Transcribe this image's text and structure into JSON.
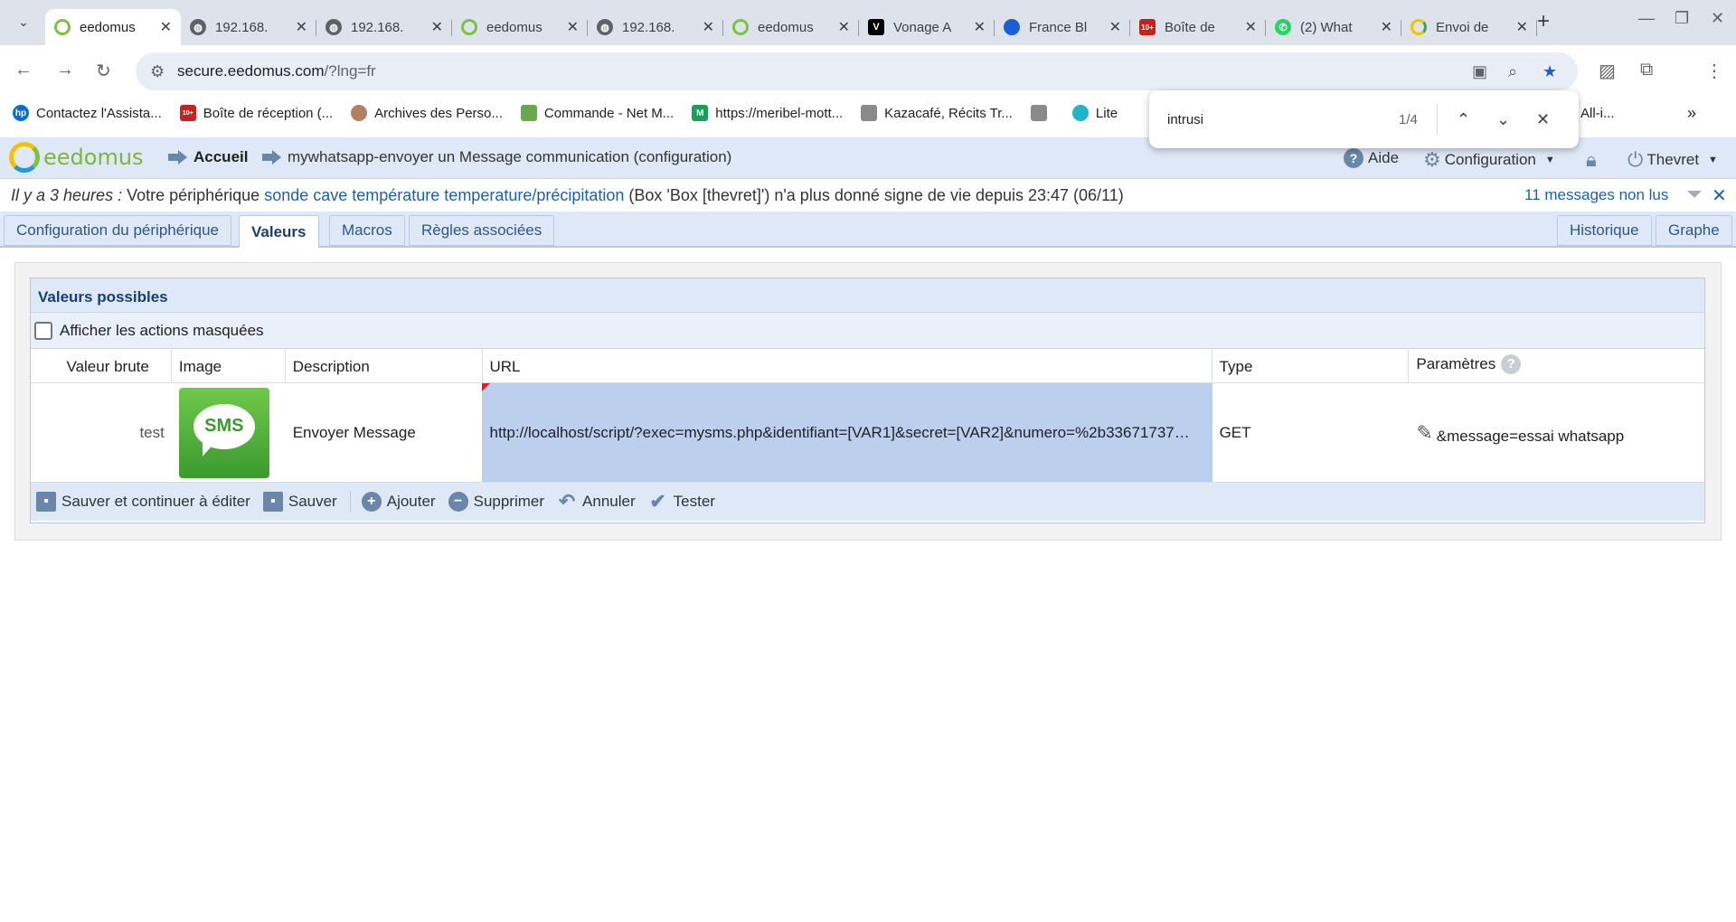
{
  "browser": {
    "tabs": [
      {
        "title": "eedomus",
        "active": true,
        "icon": "eedomus-icon"
      },
      {
        "title": "192.168.",
        "icon": "globe-icon"
      },
      {
        "title": "192.168.",
        "icon": "globe-icon"
      },
      {
        "title": "eedomus",
        "icon": "eedomus-icon"
      },
      {
        "title": "192.168.",
        "icon": "globe-icon"
      },
      {
        "title": "eedomus",
        "icon": "eedomus-icon"
      },
      {
        "title": "Vonage A",
        "icon": "vonage-icon"
      },
      {
        "title": "France Bl",
        "icon": "francebleu-icon"
      },
      {
        "title": "Boîte de",
        "icon": "mail-icon"
      },
      {
        "title": "(2) What",
        "icon": "whatsapp-icon"
      },
      {
        "title": "Envoi de",
        "icon": "google-icon"
      }
    ],
    "url_host": "secure.eedomus.com",
    "url_path": "/?lng=fr",
    "bookmarks": [
      {
        "label": "Contactez l'Assista...",
        "icon": "hp-icon",
        "color": "#0a6ed1"
      },
      {
        "label": "Boîte de réception (...",
        "icon": "mail-icon",
        "color": "#c5221f"
      },
      {
        "label": "Archives des Perso...",
        "icon": "avatar-icon",
        "color": "#b08060"
      },
      {
        "label": "Commande - Net M...",
        "icon": "cart-icon",
        "color": "#6aa84f"
      },
      {
        "label": "https://meribel-mott...",
        "icon": "m-icon",
        "color": "#1a9e5c"
      },
      {
        "label": "Kazacafé, Récits Tr...",
        "icon": "image-icon",
        "color": "#8a8a8a"
      },
      {
        "label": "",
        "icon": "image-icon",
        "color": "#8a8a8a"
      },
      {
        "label": "Lite",
        "icon": "lite-icon",
        "color": "#1fb5c9"
      },
      {
        "label": "All-i...",
        "icon": "folder-icon",
        "color": "#8a8a8a"
      }
    ],
    "find": {
      "query": "intrusi",
      "count": "1/4"
    }
  },
  "app": {
    "logo_text": "eedomus",
    "breadcrumb_home": "Accueil",
    "breadcrumb_page": "mywhatsapp-envoyer un Message communication (configuration)",
    "help": "Aide",
    "config": "Configuration",
    "user": "Thevret",
    "notification": {
      "when": "Il y a 3 heures :",
      "prefix": " Votre périphérique ",
      "device": "sonde cave température temperature/précipitation",
      "suffix": " (Box 'Box [thevret]') n'a plus donné signe de vie depuis 23:47 (06/11)",
      "unread": "11 messages non lus"
    },
    "tabs": {
      "config": "Configuration du périphérique",
      "values": "Valeurs",
      "macros": "Macros",
      "rules": "Règles associées",
      "history": "Historique",
      "graph": "Graphe"
    },
    "panel": {
      "title": "Valeurs possibles",
      "show_hidden": "Afficher les actions masquées",
      "columns": {
        "raw": "Valeur brute",
        "image": "Image",
        "description": "Description",
        "url": "URL",
        "type": "Type",
        "params": "Paramètres"
      },
      "row": {
        "raw": "test",
        "image_text": "SMS",
        "description": "Envoyer Message",
        "url": "http://localhost/script/?exec=mysms.php&identifiant=[VAR1]&secret=[VAR2]&numero=%2b33671737…",
        "type": "GET",
        "params": "&message=essai whatsapp"
      },
      "actions": {
        "save_continue": "Sauver et continuer à éditer",
        "save": "Sauver",
        "add": "Ajouter",
        "delete": "Supprimer",
        "cancel": "Annuler",
        "test": "Tester"
      }
    }
  }
}
